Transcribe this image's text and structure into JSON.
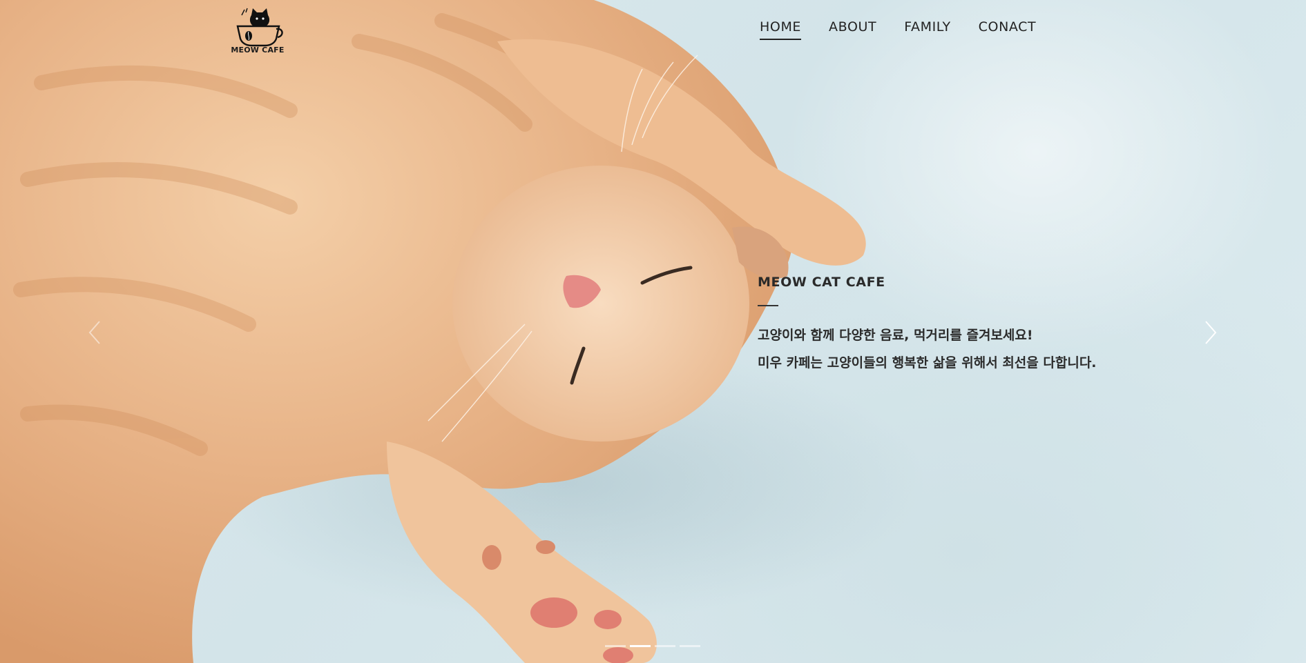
{
  "brand": {
    "name": "MEOW CAFE"
  },
  "nav": {
    "items": [
      {
        "label": "HOME",
        "active": true
      },
      {
        "label": "ABOUT",
        "active": false
      },
      {
        "label": "FAMILY",
        "active": false
      },
      {
        "label": "CONACT",
        "active": false
      }
    ]
  },
  "hero": {
    "title": "MEOW CAT CAFE",
    "line1": "고양이와 함께 다양한 음료, 먹거리를 즐겨보세요!",
    "line2": "미우 카페는 고양이들의 행복한 삶을 위해서 최선을 다합니다.",
    "prev_icon": "chevron-left-icon",
    "next_icon": "chevron-right-icon",
    "background_subject": "sleeping orange kitten on pale blue background"
  },
  "slider": {
    "total_slides": 4,
    "active_index": 1
  },
  "colors": {
    "background": "#d6e6ea",
    "text": "#222222",
    "fur": "#e9b98f",
    "pager_active": "#ffffff"
  }
}
